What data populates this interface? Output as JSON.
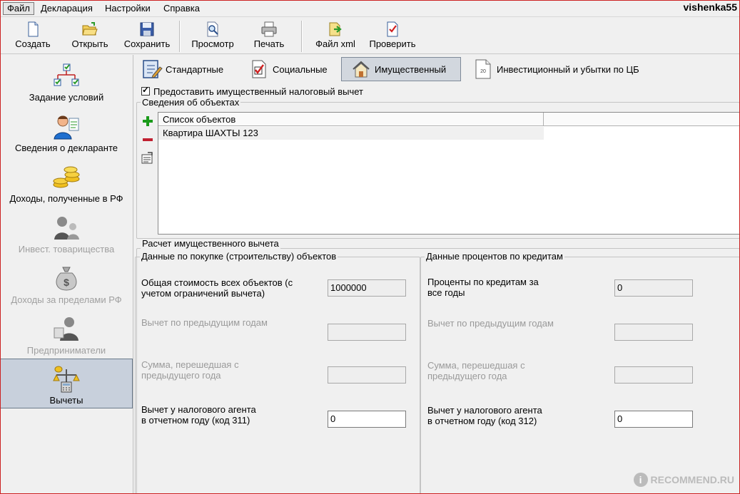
{
  "menu": {
    "items": [
      "Файл",
      "Декларация",
      "Настройки",
      "Справка"
    ],
    "username": "vishenka55"
  },
  "toolbar": {
    "create": "Создать",
    "open": "Открыть",
    "save": "Сохранить",
    "preview": "Просмотр",
    "print": "Печать",
    "xml": "Файл xml",
    "check": "Проверить"
  },
  "sidebar": {
    "items": [
      {
        "label": "Задание условий",
        "state": "normal"
      },
      {
        "label": "Сведения о декларанте",
        "state": "normal"
      },
      {
        "label": "Доходы, полученные в РФ",
        "state": "normal"
      },
      {
        "label": "Инвест. товарищества",
        "state": "disabled"
      },
      {
        "label": "Доходы за пределами РФ",
        "state": "disabled"
      },
      {
        "label": "Предприниматели",
        "state": "disabled"
      },
      {
        "label": "Вычеты",
        "state": "selected"
      }
    ]
  },
  "tabs": {
    "standard": "Стандартные",
    "social": "Социальные",
    "property": "Имущественный",
    "invest": "Инвестиционный и убытки по ЦБ"
  },
  "property": {
    "provide_deduction": "Предоставить имущественный налоговый вычет",
    "objects_group": "Сведения об объектах",
    "objects_header": "Список объектов",
    "objects": [
      "Квартира ШАХТЫ 123"
    ],
    "calc_group": "Расчет имущественного вычета",
    "purchase_group": "Данные по покупке (строительству) объектов",
    "interest_group": "Данные процентов по кредитам",
    "purchase": {
      "total_label": "Общая стоимость всех объектов (с учетом ограничений вычета)",
      "total_value": "1000000",
      "prev_years_label": "Вычет по предыдущим годам",
      "prev_years_value": "",
      "carry_label": "Сумма, перешедшая с предыдущего года",
      "carry_value": "",
      "agent_label": "Вычет у налогового агента в отчетном году (код 311)",
      "agent_value": "0"
    },
    "interest": {
      "total_label": "Проценты по кредитам за все годы",
      "total_value": "0",
      "prev_years_label": "Вычет по предыдущим годам",
      "prev_years_value": "",
      "carry_label": "Сумма, перешедшая с предыдущего года",
      "carry_value": "",
      "agent_label": "Вычет у налогового агента в отчетном году (код 312)",
      "agent_value": "0"
    }
  },
  "watermark": {
    "glyph": "i",
    "text": "RECOMMEND.RU"
  }
}
